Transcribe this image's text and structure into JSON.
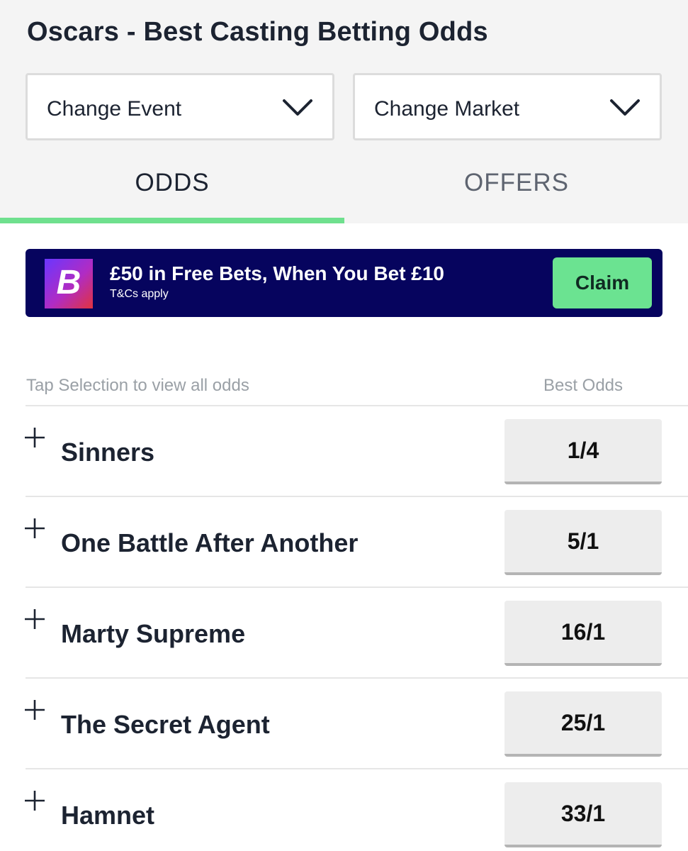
{
  "header": {
    "title": "Oscars - Best Casting Betting Odds"
  },
  "filters": {
    "event_label": "Change Event",
    "market_label": "Change Market"
  },
  "tabs": [
    {
      "label": "ODDS",
      "active": true
    },
    {
      "label": "OFFERS",
      "active": false
    }
  ],
  "promo": {
    "logo_letter": "B",
    "headline": "£50 in Free Bets, When You Bet £10",
    "terms": "T&Cs apply",
    "cta": "Claim"
  },
  "list": {
    "hint": "Tap Selection to view all odds",
    "column_header": "Best Odds",
    "rows": [
      {
        "name": "Sinners",
        "odds": "1/4"
      },
      {
        "name": "One Battle After Another",
        "odds": "5/1"
      },
      {
        "name": "Marty Supreme",
        "odds": "16/1"
      },
      {
        "name": "The Secret Agent",
        "odds": "25/1"
      },
      {
        "name": "Hamnet",
        "odds": "33/1"
      }
    ]
  },
  "colors": {
    "accent_green": "#6fe08e",
    "promo_bg": "#06045e",
    "claim_bg": "#6be391",
    "text_dark": "#1c2331"
  },
  "icons": {
    "dropdown": "chevron-down-icon",
    "expand": "plus-icon"
  }
}
